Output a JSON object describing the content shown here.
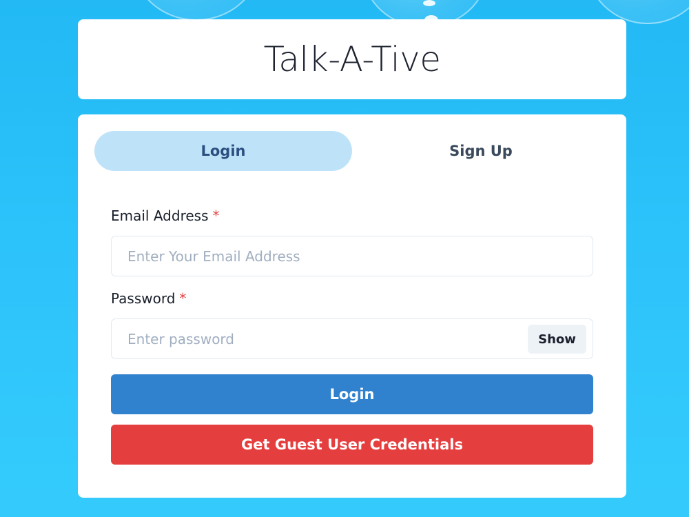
{
  "app": {
    "title": "Talk-A-Tive"
  },
  "tabs": [
    {
      "label": "Login",
      "active": true
    },
    {
      "label": "Sign Up",
      "active": false
    }
  ],
  "form": {
    "email": {
      "label": "Email Address",
      "required_mark": "*",
      "placeholder": "Enter Your Email Address",
      "value": ""
    },
    "password": {
      "label": "Password",
      "required_mark": "*",
      "placeholder": "Enter password",
      "value": "",
      "toggle_label": "Show"
    },
    "login_button": "Login",
    "guest_button": "Get Guest User Credentials"
  },
  "colors": {
    "background": "#2ec4fb",
    "active_tab": "#bee3f8",
    "login_button": "#3182ce",
    "guest_button": "#e53e3e",
    "required_mark": "#e53e3e"
  }
}
